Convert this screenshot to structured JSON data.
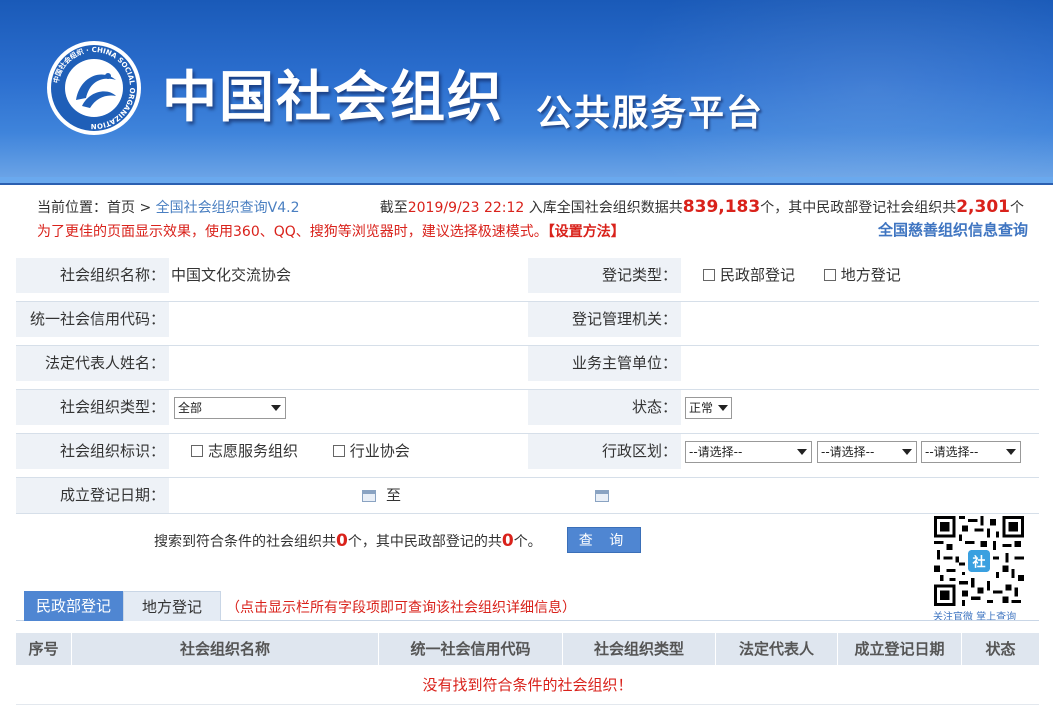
{
  "header": {
    "logo_ring_text": "中国社会组织 · CHINA SOCIAL ORGANIZATION",
    "title_main": "中国社会组织",
    "title_sub": "公共服务平台"
  },
  "breadcrumb": {
    "prefix": "当前位置：",
    "home": "首页",
    "separator": " > ",
    "current": "全国社会组织查询V4.2"
  },
  "stats": {
    "t1": "截至",
    "date": "2019/9/23 22:12",
    "t2": " 入库全国社会组织数据共",
    "total": "839,183",
    "t3": "个，其中民政部登记社会组织共",
    "ministry": "2,301",
    "t4": "个"
  },
  "tip": {
    "text": "为了更佳的页面显示效果，使用360、QQ、搜狗等浏览器时，建议选择极速模式。",
    "link": "【设置方法】"
  },
  "charity_link": "全国慈善组织信息查询",
  "form": {
    "org_name_label": "社会组织名称：",
    "org_name_value": "中国文化交流协会",
    "reg_type_label": "登记类型：",
    "reg_type_opt1": "民政部登记",
    "reg_type_opt2": "地方登记",
    "credit_code_label": "统一社会信用代码：",
    "reg_authority_label": "登记管理机关：",
    "legal_rep_label": "法定代表人姓名：",
    "supervisor_label": "业务主管单位：",
    "org_type_label": "社会组织类型：",
    "org_type_value": "全部",
    "status_label": "状态：",
    "status_value": "正常",
    "org_mark_label": "社会组织标识：",
    "org_mark_opt1": "志愿服务组织",
    "org_mark_opt2": "行业协会",
    "region_label": "行政区划：",
    "region_1": "--请选择--",
    "region_2": "--请选择--",
    "region_3": "--请选择--",
    "date_label": "成立登记日期：",
    "date_to": "至"
  },
  "result": {
    "t1": "搜索到符合条件的社会组织共",
    "count": "0",
    "t2": "个，其中民政部登记的共",
    "ministry_count": "0",
    "t3": "个。",
    "search_button": "查 询"
  },
  "qr": {
    "badge": "社",
    "caption": "关注官微 掌上查询"
  },
  "tabs": {
    "active": "民政部登记",
    "inactive": "地方登记",
    "hint": "（点击显示栏所有字段项即可查询该社会组织详细信息）"
  },
  "table": {
    "columns": [
      "序号",
      "社会组织名称",
      "统一社会信用代码",
      "社会组织类型",
      "法定代表人",
      "成立登记日期",
      "状态"
    ],
    "empty_message": "没有找到符合条件的社会组织！"
  },
  "colors": {
    "banner": "#2c6fcf",
    "accent_blue": "#4f86d2",
    "alert_red": "#d9221b",
    "label_bg": "#eef2f7"
  }
}
